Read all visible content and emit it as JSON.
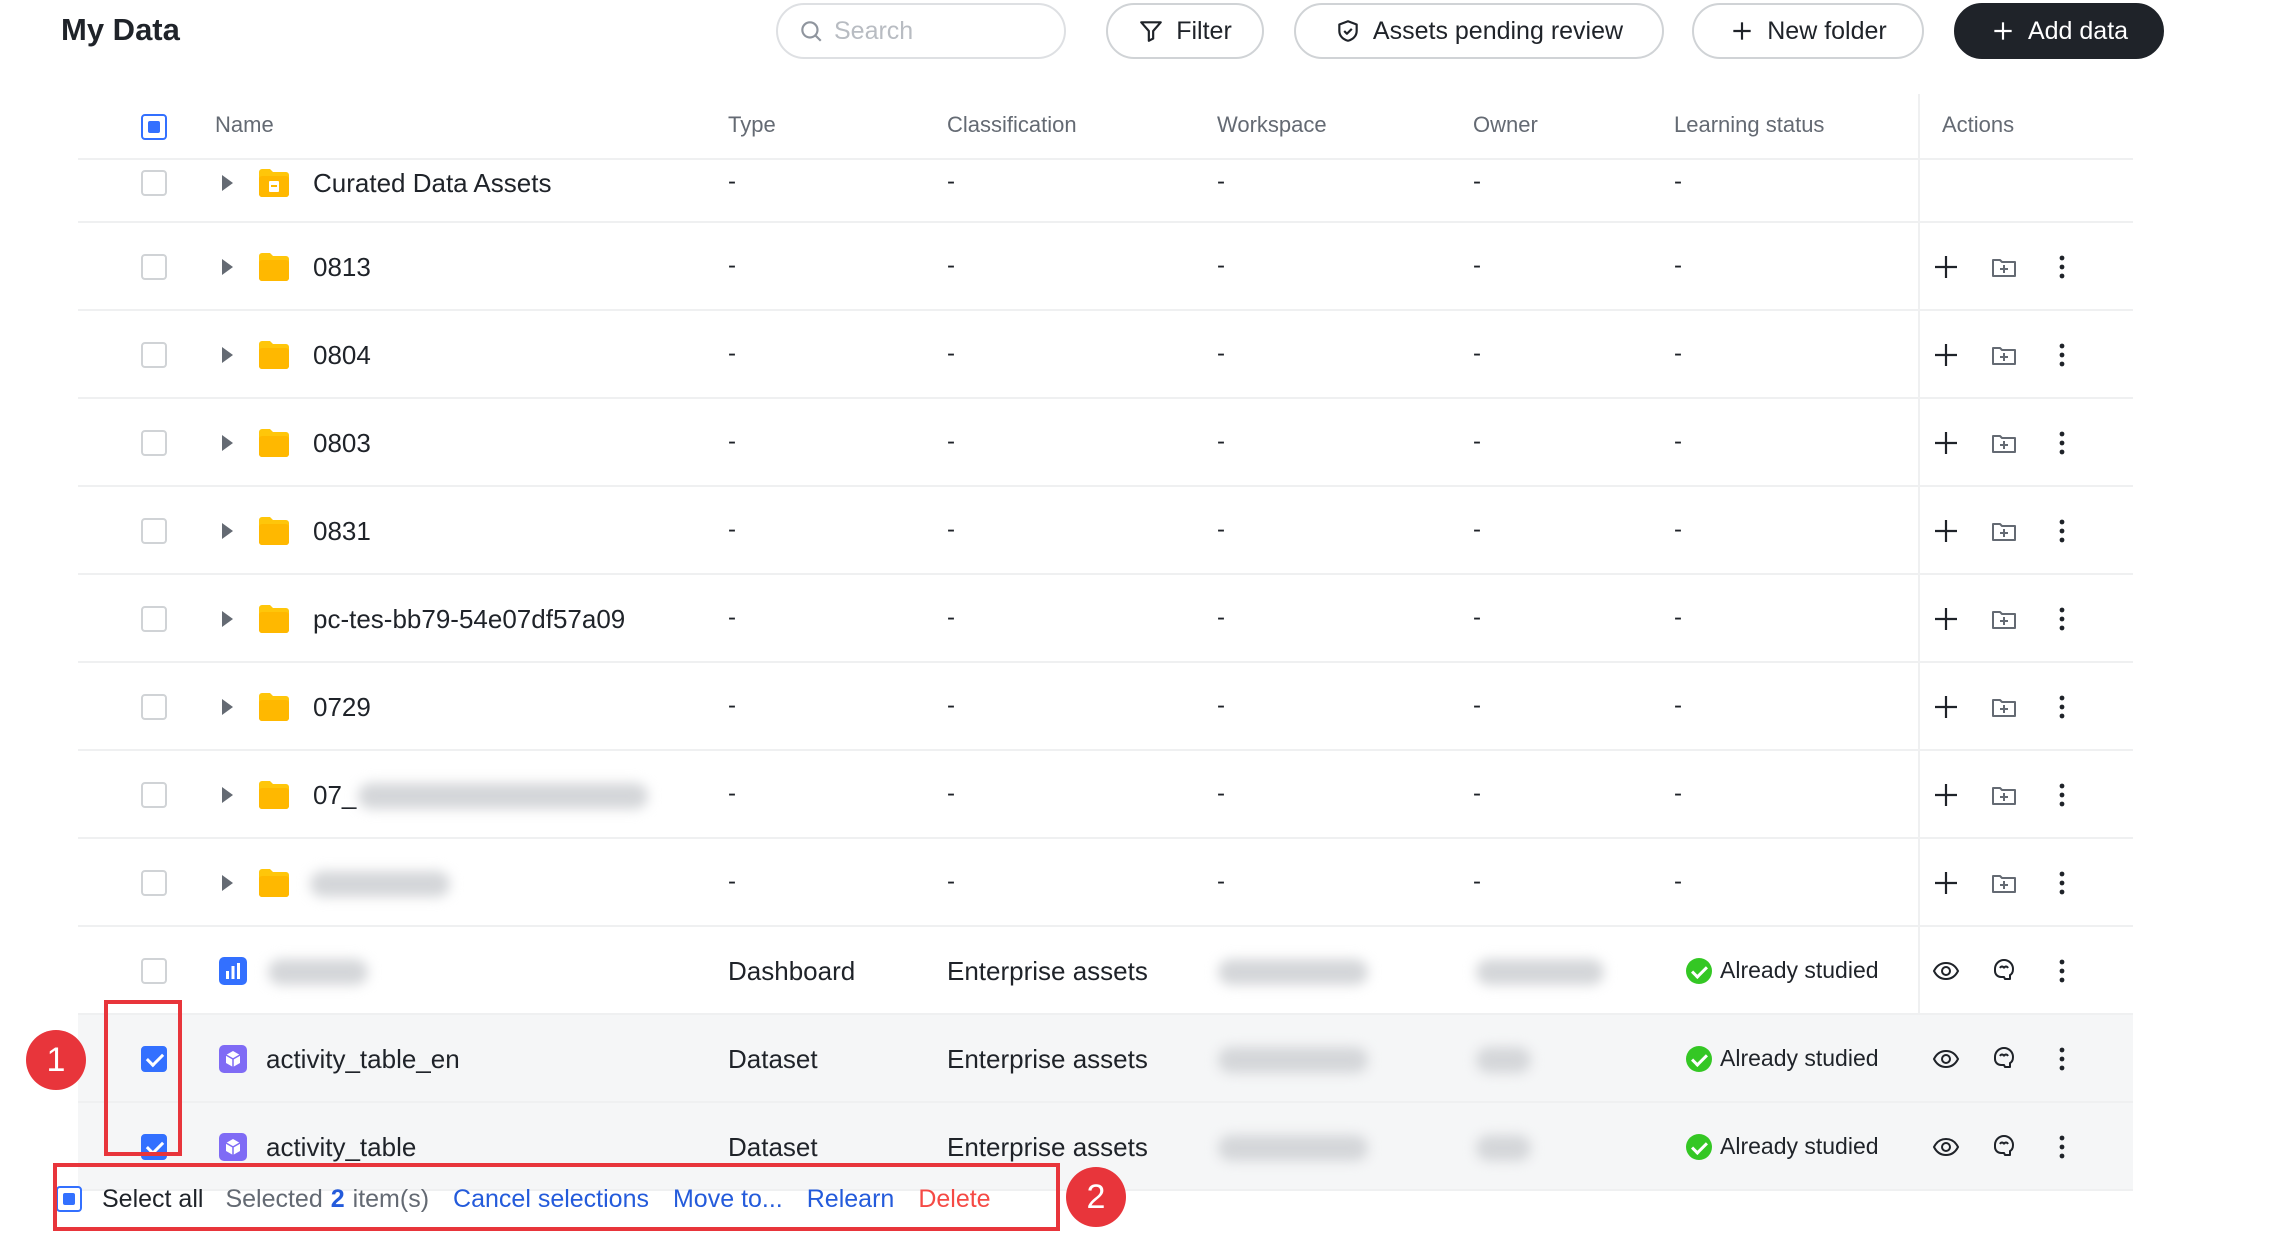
{
  "page": {
    "title": "My Data"
  },
  "toolbar": {
    "search_placeholder": "Search",
    "filter_label": "Filter",
    "pending_label": "Assets pending review",
    "new_folder_label": "New folder",
    "add_data_label": "Add data"
  },
  "table": {
    "columns": [
      "Name",
      "Type",
      "Classification",
      "Workspace",
      "Owner",
      "Learning status",
      "Actions"
    ],
    "rows": [
      {
        "name": "Curated Data Assets",
        "kind": "folder",
        "type": "-",
        "classification": "-",
        "workspace": "-",
        "owner": "-",
        "status": "-",
        "checked": false
      },
      {
        "name": "0813",
        "kind": "folder",
        "type": "-",
        "classification": "-",
        "workspace": "-",
        "owner": "-",
        "status": "-",
        "checked": false
      },
      {
        "name": "0804",
        "kind": "folder",
        "type": "-",
        "classification": "-",
        "workspace": "-",
        "owner": "-",
        "status": "-",
        "checked": false
      },
      {
        "name": "0803",
        "kind": "folder",
        "type": "-",
        "classification": "-",
        "workspace": "-",
        "owner": "-",
        "status": "-",
        "checked": false
      },
      {
        "name": "0831",
        "kind": "folder",
        "type": "-",
        "classification": "-",
        "workspace": "-",
        "owner": "-",
        "status": "-",
        "checked": false
      },
      {
        "name": "pc-tes-bb79-54e07df57a09",
        "kind": "folder",
        "type": "-",
        "classification": "-",
        "workspace": "-",
        "owner": "-",
        "status": "-",
        "checked": false
      },
      {
        "name": "0729",
        "kind": "folder",
        "type": "-",
        "classification": "-",
        "workspace": "-",
        "owner": "-",
        "status": "-",
        "checked": false
      },
      {
        "name": "07_",
        "kind": "folder",
        "type": "-",
        "classification": "-",
        "workspace": "-",
        "owner": "-",
        "status": "-",
        "checked": false
      },
      {
        "name": "",
        "kind": "folder",
        "type": "-",
        "classification": "-",
        "workspace": "-",
        "owner": "-",
        "status": "-",
        "checked": false
      },
      {
        "name": "",
        "kind": "dashboard",
        "type": "Dashboard",
        "classification": "Enterprise assets",
        "workspace": "",
        "owner": "",
        "status": "Already studied",
        "checked": false
      },
      {
        "name": "activity_table_en",
        "kind": "dataset",
        "type": "Dataset",
        "classification": "Enterprise assets",
        "workspace": "",
        "owner": "",
        "status": "Already studied",
        "checked": true
      },
      {
        "name": "activity_table",
        "kind": "dataset",
        "type": "Dataset",
        "classification": "Enterprise assets",
        "workspace": "",
        "owner": "",
        "status": "Already studied",
        "checked": true
      }
    ]
  },
  "footer": {
    "select_all": "Select all",
    "selected_prefix": "Selected",
    "selected_count": "2",
    "selected_suffix": "item(s)",
    "cancel": "Cancel selections",
    "move": "Move to...",
    "relearn": "Relearn",
    "delete": "Delete"
  },
  "annotations": {
    "badge1": "1",
    "badge2": "2"
  },
  "colors": {
    "accent": "#3370ff",
    "link": "#245bdb",
    "danger": "#f54a45",
    "folder": "#ffc60a",
    "annotation": "#e8353b",
    "success": "#34c724"
  }
}
